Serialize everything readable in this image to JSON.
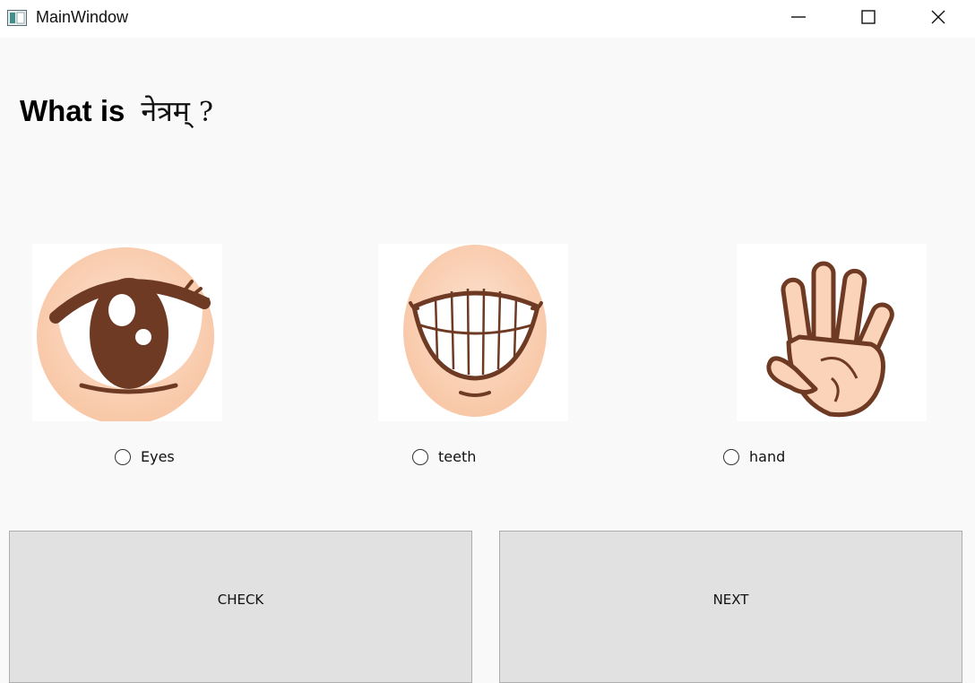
{
  "window": {
    "title": "MainWindow",
    "controls": [
      "minimize-icon",
      "maximize-icon",
      "close-icon"
    ]
  },
  "question": {
    "prefix": "What is",
    "word": "नेत्रम्",
    "mark": "?"
  },
  "options": [
    {
      "label": "Eyes",
      "icon": "eye-icon",
      "selected": false
    },
    {
      "label": "teeth",
      "icon": "teeth-icon",
      "selected": false
    },
    {
      "label": "hand",
      "icon": "hand-icon",
      "selected": false
    }
  ],
  "buttons": {
    "check": "CHECK",
    "next": "NEXT"
  },
  "colors": {
    "skin": "#fbd3b8",
    "iris": "#6e3a24",
    "button_bg": "#e1e1e1"
  }
}
